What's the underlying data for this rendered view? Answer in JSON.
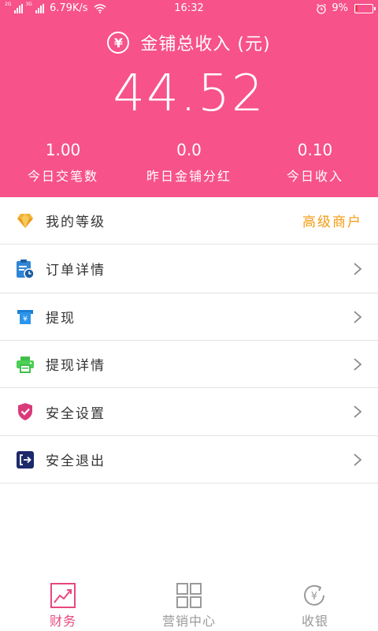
{
  "status_bar": {
    "net1": "2G",
    "net2": "3G",
    "speed": "6.79K/s",
    "time": "16:32",
    "battery": "9%",
    "battery_level": 0.09
  },
  "header": {
    "title": "金铺总收入 (元)",
    "currency_icon": "yen-circle-icon",
    "total": "44.52",
    "stats": [
      {
        "value": "1.00",
        "label": "今日交笔数"
      },
      {
        "value": "0.0",
        "label": "昨日金铺分红"
      },
      {
        "value": "0.10",
        "label": "今日收入"
      }
    ]
  },
  "menu": {
    "level": {
      "label": "我的等级",
      "value": "高级商户",
      "icon": "diamond-icon"
    },
    "orders": {
      "label": "订单详情",
      "icon": "clipboard-clock-icon"
    },
    "withdraw": {
      "label": "提现",
      "icon": "yen-box-icon"
    },
    "withdraw_details": {
      "label": "提现详情",
      "icon": "printer-icon"
    },
    "security": {
      "label": "安全设置",
      "icon": "shield-check-icon"
    },
    "logout": {
      "label": "安全退出",
      "icon": "exit-icon"
    }
  },
  "bottom_nav": [
    {
      "label": "财务",
      "icon": "chart-trend-icon",
      "active": true
    },
    {
      "label": "营销中心",
      "icon": "grid-icon",
      "active": false
    },
    {
      "label": "收银",
      "icon": "cashier-icon",
      "active": false
    }
  ],
  "colors": {
    "primary": "#f7528a",
    "active_nav": "#e8477f",
    "level_value": "#f39c12",
    "inactive": "#9a9a9a"
  }
}
